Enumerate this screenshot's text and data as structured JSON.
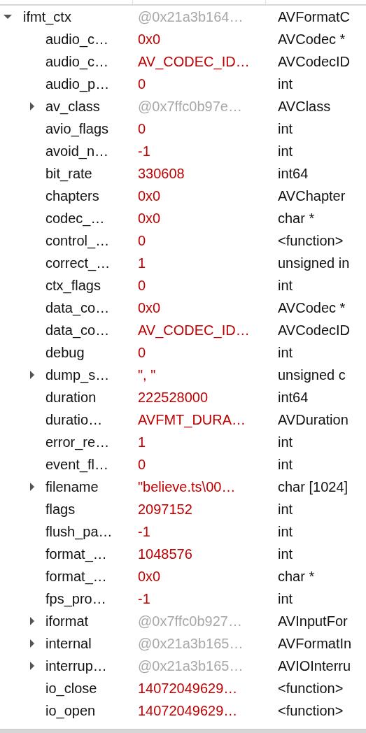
{
  "tree": [
    {
      "name": "ifmt_ctx",
      "value": "@0x21a3b164…",
      "dimmed": true,
      "type": "AVFormatC",
      "expanded": true,
      "children": [
        {
          "name": "audio_c…",
          "value": "0x0",
          "dimmed": false,
          "type": "AVCodec *"
        },
        {
          "name": "audio_c…",
          "value": "AV_CODEC_ID…",
          "dimmed": false,
          "type": "AVCodecID"
        },
        {
          "name": "audio_p…",
          "value": "0",
          "dimmed": false,
          "type": "int"
        },
        {
          "name": "av_class",
          "value": "@0x7ffc0b97e…",
          "dimmed": true,
          "type": "AVClass",
          "expanded": false
        },
        {
          "name": "avio_flags",
          "value": "0",
          "dimmed": false,
          "type": "int"
        },
        {
          "name": "avoid_n…",
          "value": "-1",
          "dimmed": false,
          "type": "int"
        },
        {
          "name": "bit_rate",
          "value": "330608",
          "dimmed": false,
          "type": "int64"
        },
        {
          "name": "chapters",
          "value": "0x0",
          "dimmed": false,
          "type": "AVChapter"
        },
        {
          "name": "codec_…",
          "value": "0x0",
          "dimmed": false,
          "type": "char *"
        },
        {
          "name": "control_…",
          "value": "0",
          "dimmed": false,
          "type": "<function>"
        },
        {
          "name": "correct_…",
          "value": "1",
          "dimmed": false,
          "type": "unsigned in"
        },
        {
          "name": "ctx_flags",
          "value": "0",
          "dimmed": false,
          "type": "int"
        },
        {
          "name": "data_co…",
          "value": "0x0",
          "dimmed": false,
          "type": "AVCodec *"
        },
        {
          "name": "data_co…",
          "value": "AV_CODEC_ID…",
          "dimmed": false,
          "type": "AVCodecID"
        },
        {
          "name": "debug",
          "value": "0",
          "dimmed": false,
          "type": "int"
        },
        {
          "name": "dump_s…",
          "value": "\", \"",
          "dimmed": false,
          "type": "unsigned c",
          "expanded": false
        },
        {
          "name": "duration",
          "value": "222528000",
          "dimmed": false,
          "type": "int64"
        },
        {
          "name": "duratio…",
          "value": "AVFMT_DURA…",
          "dimmed": false,
          "type": "AVDuration"
        },
        {
          "name": "error_re…",
          "value": "1",
          "dimmed": false,
          "type": "int"
        },
        {
          "name": "event_fl…",
          "value": "0",
          "dimmed": false,
          "type": "int"
        },
        {
          "name": "filename",
          "value": "\"believe.ts\\00…",
          "dimmed": false,
          "type": "char [1024]",
          "expanded": false
        },
        {
          "name": "flags",
          "value": "2097152",
          "dimmed": false,
          "type": "int"
        },
        {
          "name": "flush_pa…",
          "value": "-1",
          "dimmed": false,
          "type": "int"
        },
        {
          "name": "format_…",
          "value": "1048576",
          "dimmed": false,
          "type": "int"
        },
        {
          "name": "format_…",
          "value": "0x0",
          "dimmed": false,
          "type": "char *"
        },
        {
          "name": "fps_pro…",
          "value": "-1",
          "dimmed": false,
          "type": "int"
        },
        {
          "name": "iformat",
          "value": "@0x7ffc0b927…",
          "dimmed": true,
          "type": "AVInputFor",
          "expanded": false
        },
        {
          "name": "internal",
          "value": "@0x21a3b165…",
          "dimmed": true,
          "type": "AVFormatIn",
          "expanded": false
        },
        {
          "name": "interrup…",
          "value": "@0x21a3b165…",
          "dimmed": true,
          "type": "AVIOInterru",
          "expanded": false
        },
        {
          "name": "io_close",
          "value": "14072049629…",
          "dimmed": false,
          "type": "<function>"
        },
        {
          "name": "io_open",
          "value": "14072049629…",
          "dimmed": false,
          "type": "<function>"
        }
      ]
    }
  ]
}
